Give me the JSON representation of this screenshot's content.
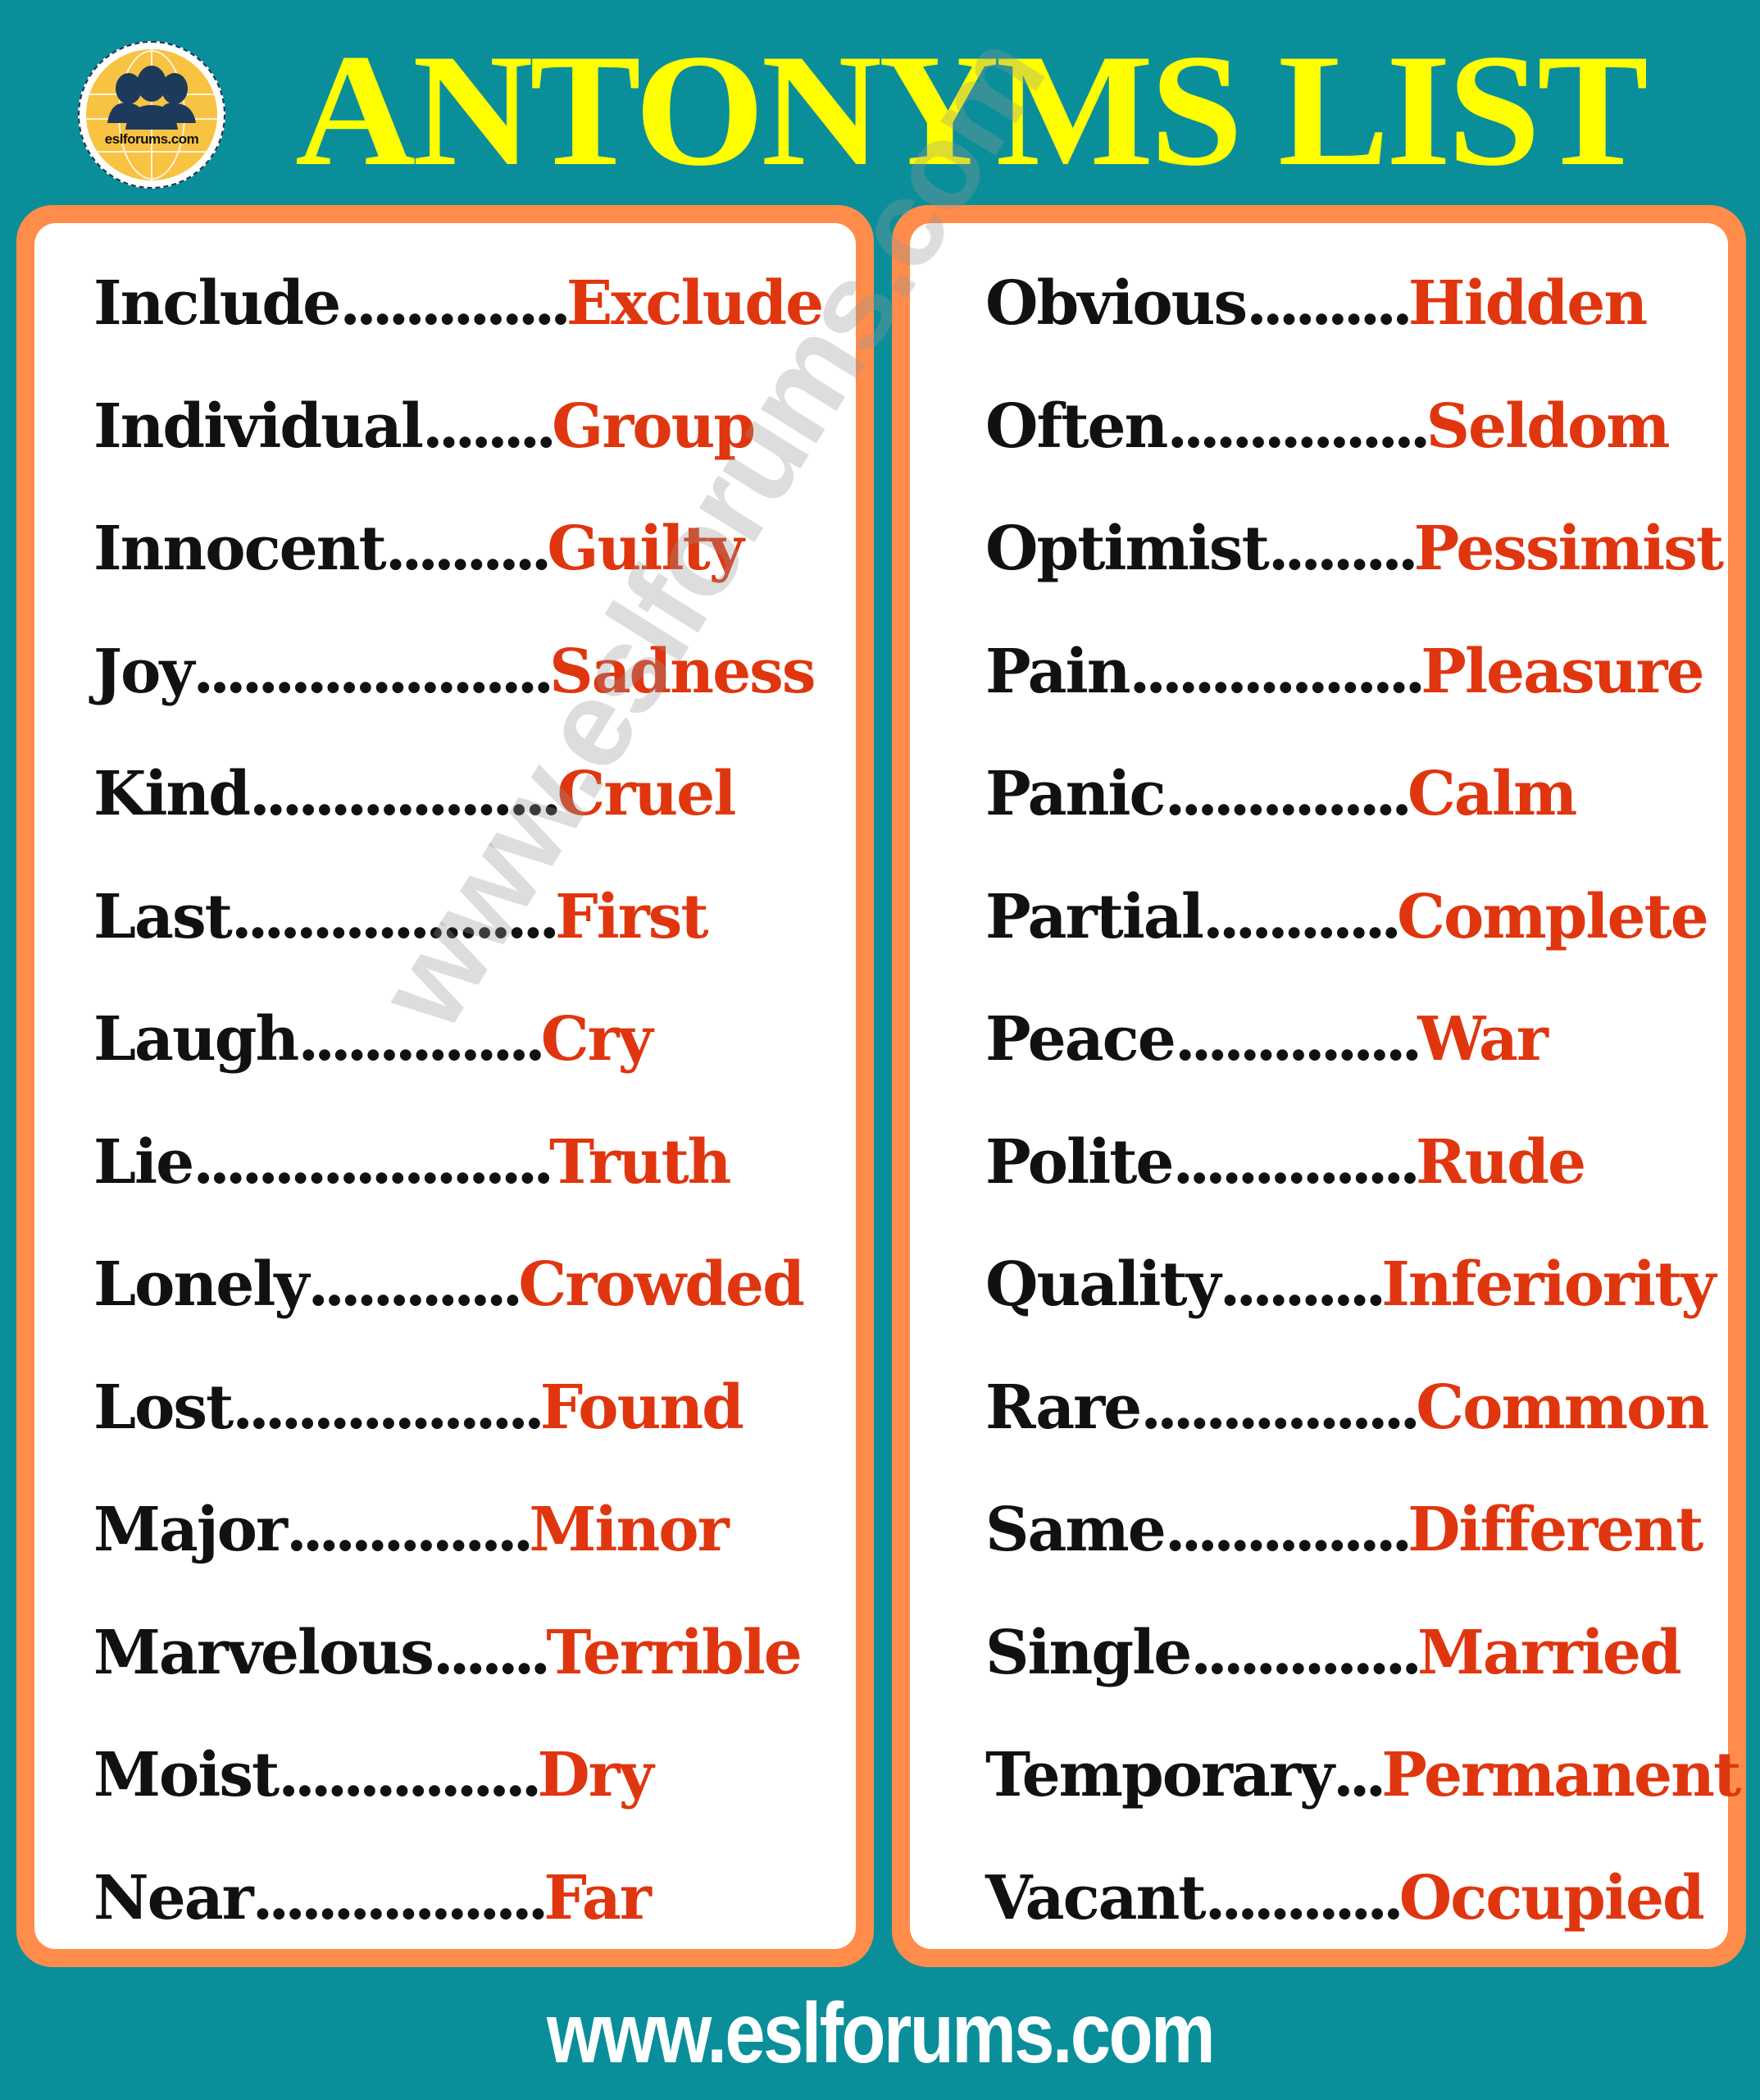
{
  "logo": {
    "text": "eslforums.com",
    "icon": "people-globe-icon"
  },
  "title": "ANTONYMS LIST",
  "colors": {
    "background": "#0a8f9a",
    "title": "#ffff00",
    "panel_border": "#ff8c4a",
    "word": "#111111",
    "antonym": "#e0360f",
    "footer": "#ffffff"
  },
  "left_column": [
    {
      "word": "Include",
      "dots": "..............",
      "antonym": "Exclude"
    },
    {
      "word": "Individual",
      "dots": "........",
      "antonym": "Group"
    },
    {
      "word": "Innocent",
      "dots": "..........",
      "antonym": "Guilty"
    },
    {
      "word": "Joy",
      "dots": "......................",
      "antonym": "Sadness"
    },
    {
      "word": "Kind",
      "dots": "...................",
      "antonym": "Cruel"
    },
    {
      "word": "Last",
      "dots": "....................",
      "antonym": "First"
    },
    {
      "word": "Laugh",
      "dots": "...............",
      "antonym": "Cry"
    },
    {
      "word": "Lie",
      "dots": "......................",
      "antonym": "Truth"
    },
    {
      "word": "Lonely",
      "dots": ".............",
      "antonym": "Crowded"
    },
    {
      "word": "Lost",
      "dots": "...................",
      "antonym": "Found"
    },
    {
      "word": "Major",
      "dots": "...............",
      "antonym": "Minor"
    },
    {
      "word": "Marvelous",
      "dots": ".......",
      "antonym": "Terrible"
    },
    {
      "word": "Moist",
      "dots": "................",
      "antonym": "Dry"
    },
    {
      "word": "Near",
      "dots": "..................",
      "antonym": "Far"
    }
  ],
  "right_column": [
    {
      "word": "Obvious",
      "dots": "..........",
      "antonym": "Hidden"
    },
    {
      "word": "Often",
      "dots": "................",
      "antonym": "Seldom"
    },
    {
      "word": "Optimist",
      "dots": ".........",
      "antonym": "Pessimist"
    },
    {
      "word": "Pain",
      "dots": "..................",
      "antonym": "Pleasure"
    },
    {
      "word": "Panic",
      "dots": "...............",
      "antonym": "Calm"
    },
    {
      "word": "Partial",
      "dots": "............",
      "antonym": "Complete"
    },
    {
      "word": "Peace",
      "dots": "...............",
      "antonym": "War"
    },
    {
      "word": "Polite",
      "dots": "...............",
      "antonym": "Rude"
    },
    {
      "word": "Quality",
      "dots": "..........",
      "antonym": "Inferiority"
    },
    {
      "word": "Rare",
      "dots": ".................",
      "antonym": "Common"
    },
    {
      "word": "Same",
      "dots": "...............",
      "antonym": "Different"
    },
    {
      "word": "Single",
      "dots": "..............",
      "antonym": "Married"
    },
    {
      "word": "Temporary",
      "dots": "...",
      "antonym": "Permanent"
    },
    {
      "word": "Vacant",
      "dots": "............",
      "antonym": "Occupied"
    }
  ],
  "watermark": "www.eslforums.com",
  "footer": "www.eslforums.com"
}
